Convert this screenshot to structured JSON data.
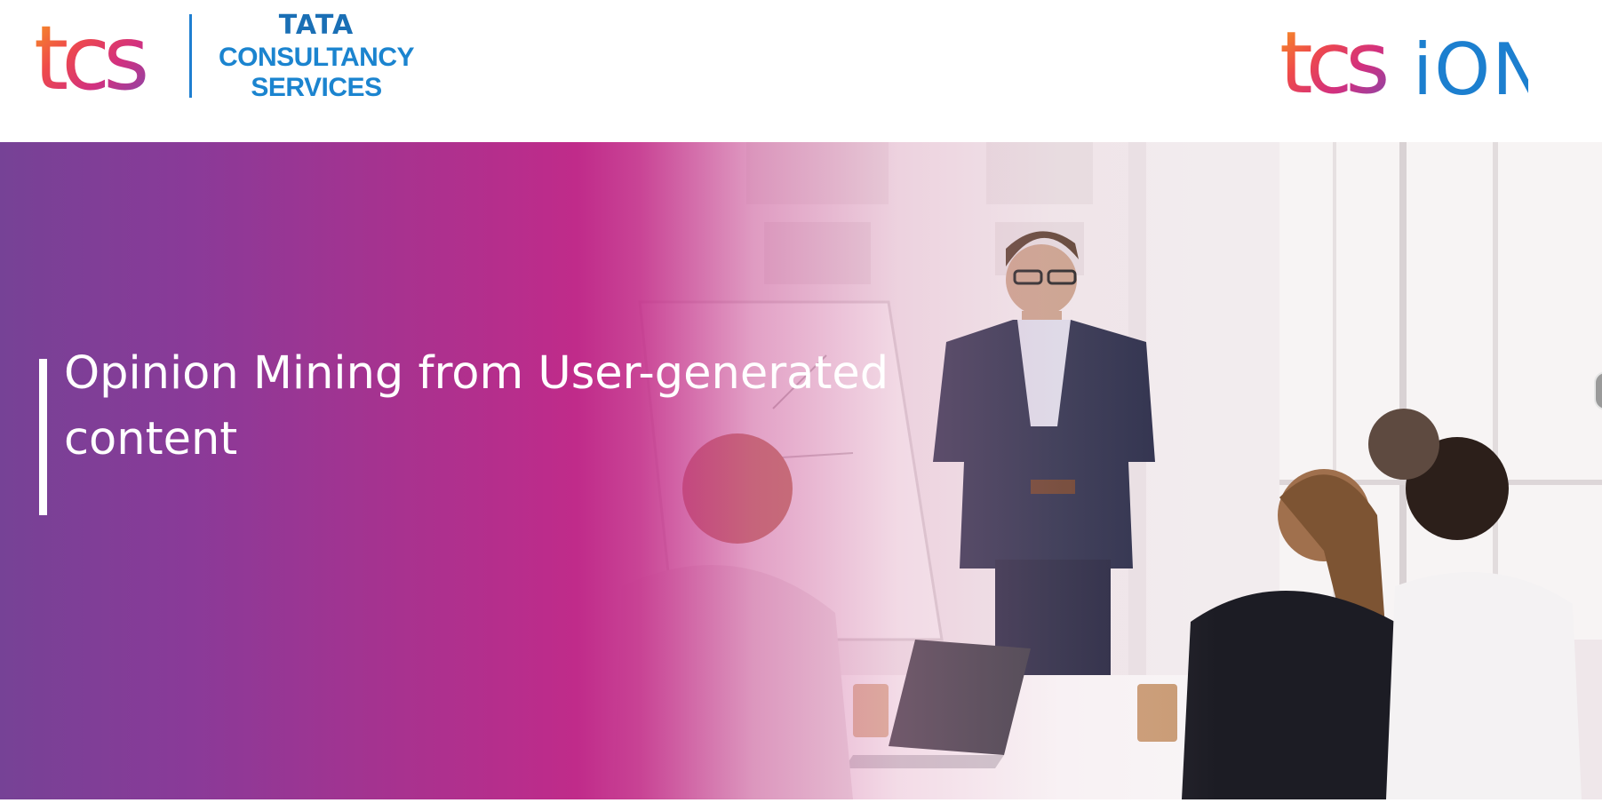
{
  "header": {
    "tcs_logo_text": "tcs",
    "company_name_line1": "TATA",
    "company_name_line2": "CONSULTANCY",
    "company_name_line3": "SERVICES",
    "ion_logo_text_tcs": "tcs",
    "ion_logo_text_ion": "iON"
  },
  "hero": {
    "title": "Opinion Mining from User-generated content"
  },
  "colors": {
    "brand_blue": "#1b84cf",
    "gradient_purple": "#764296",
    "gradient_magenta": "#c02b8a",
    "ion_blue": "#1c7fcf"
  },
  "icons": {
    "slider_indicator": "carousel-dot-icon"
  }
}
